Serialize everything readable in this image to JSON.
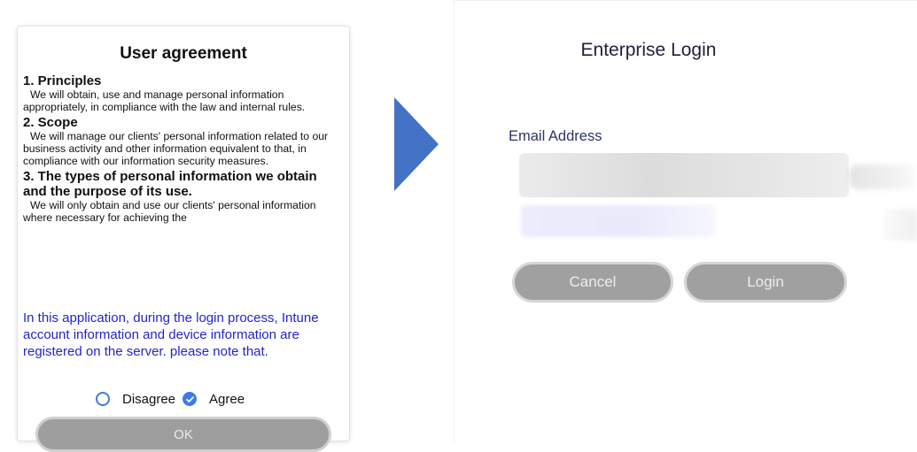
{
  "agreement": {
    "title": "User agreement",
    "sections": [
      {
        "heading": "1. Principles",
        "body": "We will obtain, use and manage personal information appropriately, in compliance with the law and internal rules."
      },
      {
        "heading": "2. Scope",
        "body": "We will manage our clients' personal information related to our business activity and other information equivalent to that, in compliance with our information security measures."
      },
      {
        "heading": "3. The types of personal information we obtain and the purpose of its use.",
        "body": "We will only obtain and use our clients' personal information where necessary for achieving the"
      }
    ],
    "notice": "In this application, during the login process, Intune account information and device information are registered on the server. please note that.",
    "disagree_label": "Disagree",
    "agree_label": "Agree",
    "selected": "Agree",
    "ok_label": "OK"
  },
  "login": {
    "title": "Enterprise Login",
    "email_label": "Email Address",
    "email_value": "",
    "email_placeholder": "",
    "cancel_label": "Cancel",
    "login_label": "Login"
  },
  "colors": {
    "accent": "#3f7be6",
    "arrow": "#4472c4",
    "notice_text": "#2424c8",
    "button_fill": "#a0a0a0"
  },
  "icons": {
    "disagree_radio": "radio-unchecked-icon",
    "agree_radio": "radio-checked-icon",
    "transition": "arrow-right-icon"
  }
}
